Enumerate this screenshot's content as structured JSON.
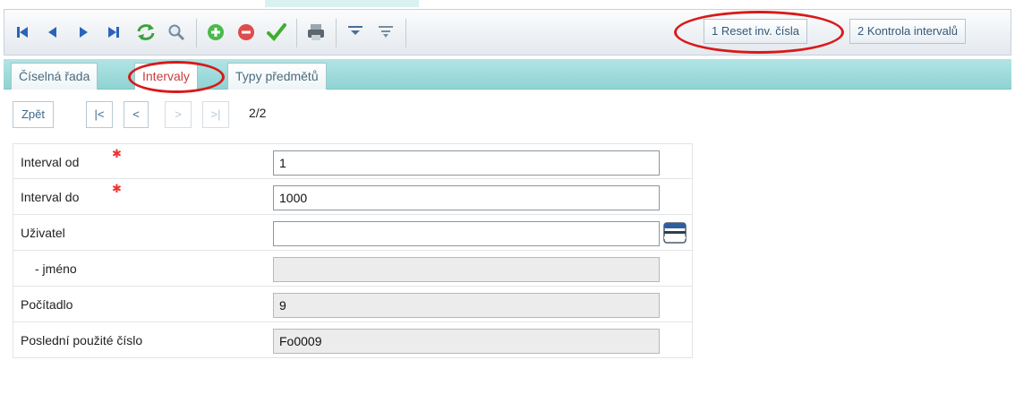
{
  "toolbar": {
    "icons": [
      "first-record-icon",
      "prev-record-icon",
      "next-record-icon",
      "last-record-icon",
      "refresh-icon",
      "search-icon",
      "add-icon",
      "delete-icon",
      "confirm-icon",
      "print-icon",
      "filter-icon",
      "filter-clear-icon"
    ],
    "actions": [
      "1 Reset inv. čísla",
      "2 Kontrola intervalů"
    ]
  },
  "tabs": [
    {
      "label": "Číselná řada",
      "active": false
    },
    {
      "label": "Intervaly",
      "active": true
    },
    {
      "label": "Typy předmětů",
      "active": false
    }
  ],
  "pager": {
    "back": "Zpět",
    "first": "|<",
    "prev": "<",
    "next": ">",
    "last": ">|",
    "count": "2/2"
  },
  "form": {
    "interval_od": {
      "label": "Interval od",
      "value": "1",
      "required": true
    },
    "interval_do": {
      "label": "Interval do",
      "value": "1000",
      "required": true
    },
    "uzivatel": {
      "label": "Uživatel",
      "value": ""
    },
    "jmeno": {
      "label": "- jméno",
      "value": ""
    },
    "pocitadlo": {
      "label": "Počítadlo",
      "value": "9"
    },
    "posledni": {
      "label": "Poslední použité číslo",
      "value": "Fo0009"
    }
  },
  "colors": {
    "accent_teal": "#9ad8d8",
    "highlight_red": "#d81a1a",
    "link_blue": "#36597a"
  }
}
